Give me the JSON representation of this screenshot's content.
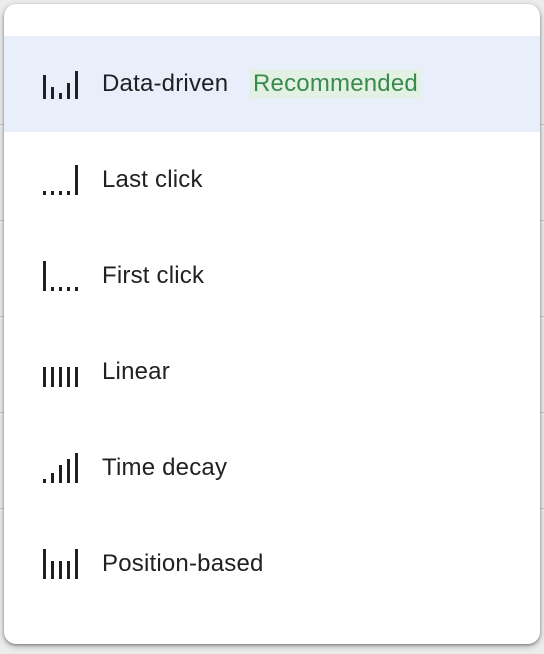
{
  "menu": {
    "items": [
      {
        "label": "Data-driven",
        "badge": "Recommended",
        "icon": "data-driven-icon",
        "selected": true
      },
      {
        "label": "Last click",
        "icon": "last-click-icon",
        "selected": false
      },
      {
        "label": "First click",
        "icon": "first-click-icon",
        "selected": false
      },
      {
        "label": "Linear",
        "icon": "linear-icon",
        "selected": false
      },
      {
        "label": "Time decay",
        "icon": "time-decay-icon",
        "selected": false
      },
      {
        "label": "Position-based",
        "icon": "position-based-icon",
        "selected": false
      }
    ]
  },
  "colors": {
    "selected_background": "#e8effb",
    "badge_text": "#3a8a4c",
    "badge_background": "#e3f1e4",
    "text": "#202124",
    "icon": "#202124"
  }
}
